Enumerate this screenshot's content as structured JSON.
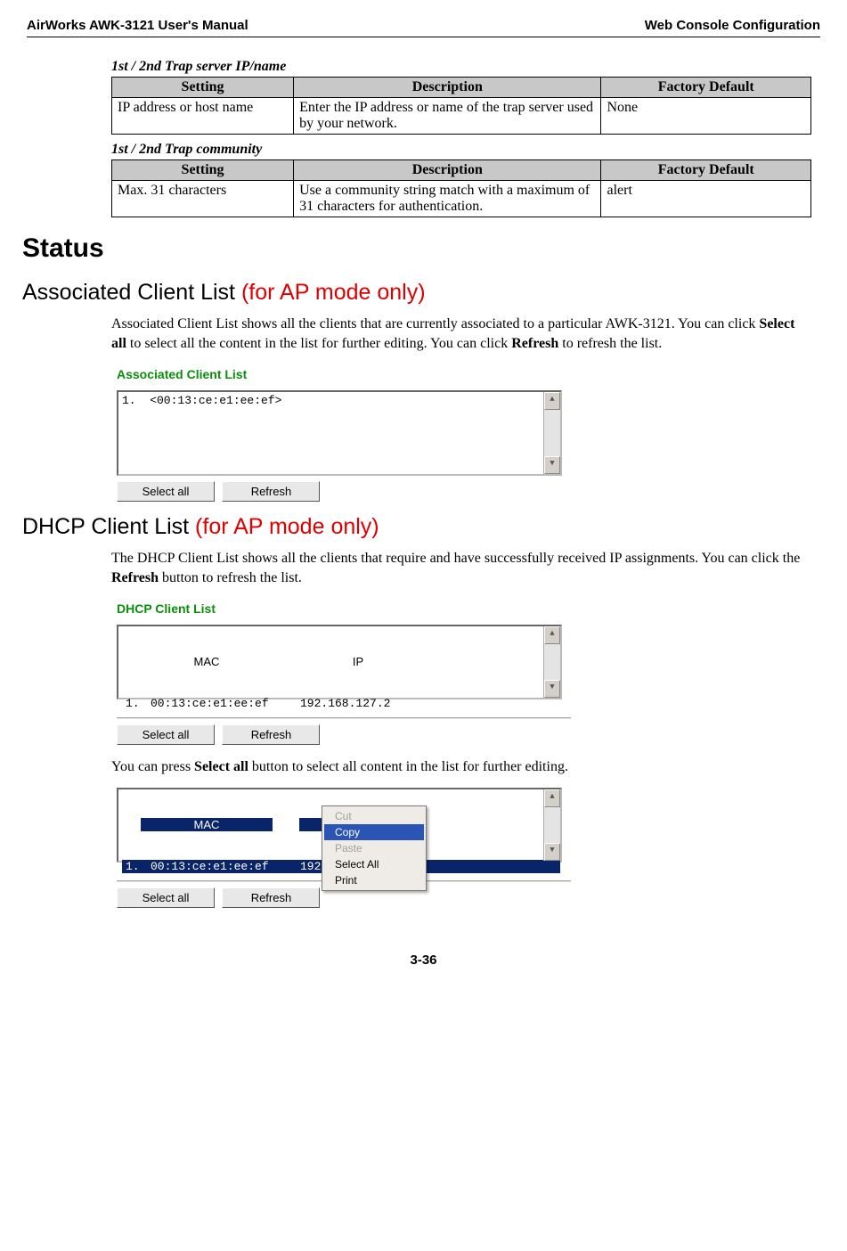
{
  "header": {
    "left": "AirWorks AWK-3121 User's Manual",
    "right": "Web Console Configuration"
  },
  "table1": {
    "title": "1st / 2nd Trap server IP/name",
    "headers": {
      "setting": "Setting",
      "description": "Description",
      "default": "Factory Default"
    },
    "rows": [
      {
        "setting": "IP address or host name",
        "description": "Enter the IP address or name of the trap server used by your network.",
        "default": "None"
      }
    ]
  },
  "table2": {
    "title": "1st / 2nd Trap community",
    "headers": {
      "setting": "Setting",
      "description": "Description",
      "default": "Factory Default"
    },
    "rows": [
      {
        "setting": "Max. 31 characters",
        "description": "Use a community string match with a maximum of 31 characters for authentication.",
        "default": "alert"
      }
    ]
  },
  "status_heading": "Status",
  "assoc": {
    "heading_plain": "Associated Client List ",
    "heading_red": "(for AP mode only)",
    "para_before_bold1": "Associated Client List shows all the clients that are currently associated to a particular AWK-3121. You can click ",
    "bold1": "Select all",
    "para_mid": " to select all the content in the list for further editing. You can click ",
    "bold2": "Refresh",
    "para_after": " to refresh the list.",
    "panel_title": "Associated Client List",
    "list_line": "1.  <00:13:ce:e1:ee:ef>",
    "btn_select": "Select all",
    "btn_refresh": "Refresh"
  },
  "dhcp": {
    "heading_plain": "DHCP Client List ",
    "heading_red": "(for AP mode only)",
    "para_before_bold": "The DHCP Client List shows all the clients that require and have successfully received IP assignments. You can click the ",
    "bold1": "Refresh",
    "para_after": " button to refresh the list.",
    "panel_title": "DHCP Client List",
    "col_mac": "MAC",
    "col_ip": "IP",
    "row_idx": "1.",
    "row_mac": "00:13:ce:e1:ee:ef",
    "row_ip": "192.168.127.2",
    "btn_select": "Select all",
    "btn_refresh": "Refresh",
    "para2_before_bold": "You can press ",
    "para2_bold": "Select all",
    "para2_after": " button to select all content in the list for further editing."
  },
  "dhcp_sel": {
    "col_mac": "MAC",
    "col_ip": "IP",
    "row_idx": "1.",
    "row_mac": "00:13:ce:e1:ee:ef",
    "row_ip": "192.168.127.2",
    "menu": {
      "cut": "Cut",
      "copy": "Copy",
      "paste": "Paste",
      "select_all": "Select All",
      "print": "Print"
    },
    "btn_select": "Select all",
    "btn_refresh": "Refresh"
  },
  "footer": "3-36"
}
